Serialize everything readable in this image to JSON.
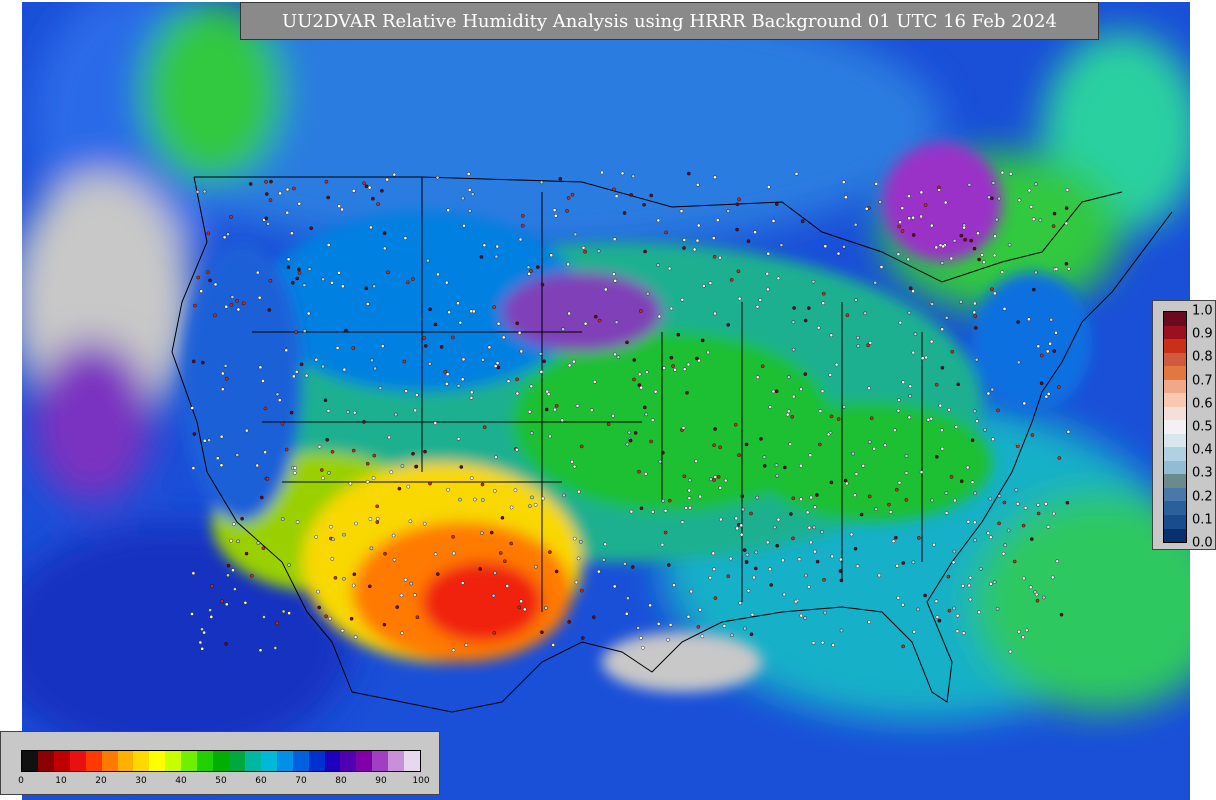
{
  "title": "UU2DVAR Relative Humidity Analysis using HRRR Background 01 UTC 16 Feb 2024",
  "humidity_colorbar": {
    "colors": [
      "#111111",
      "#8b0000",
      "#c00000",
      "#e81010",
      "#ff3a00",
      "#ff7a00",
      "#ffb000",
      "#ffd800",
      "#ffff00",
      "#c8ff00",
      "#6ef000",
      "#20d000",
      "#00b000",
      "#00a840",
      "#00b8a0",
      "#00b8d8",
      "#0090e8",
      "#0060e0",
      "#0030d0",
      "#2000c0",
      "#5000b0",
      "#8000a8",
      "#a040c0",
      "#c890d8",
      "#e8d8ee"
    ],
    "ticks": [
      "0",
      "10",
      "20",
      "30",
      "40",
      "50",
      "60",
      "70",
      "80",
      "90",
      "100"
    ]
  },
  "ratio_colorbar": {
    "colors": [
      "#6a0a1e",
      "#9a1020",
      "#c83018",
      "#d05a40",
      "#e07840",
      "#f0a888",
      "#f8c8b0",
      "#f4e0d8",
      "#f2f2f2",
      "#d8e6ee",
      "#b0d0e4",
      "#90bcd4",
      "#6a8a8e",
      "#4a78a8",
      "#2a609c",
      "#184c8c",
      "#08306b"
    ],
    "ticks": [
      "1.0",
      "0.9",
      "0.8",
      "0.7",
      "0.6",
      "0.5",
      "0.4",
      "0.3",
      "0.2",
      "0.1",
      "0.0"
    ]
  }
}
